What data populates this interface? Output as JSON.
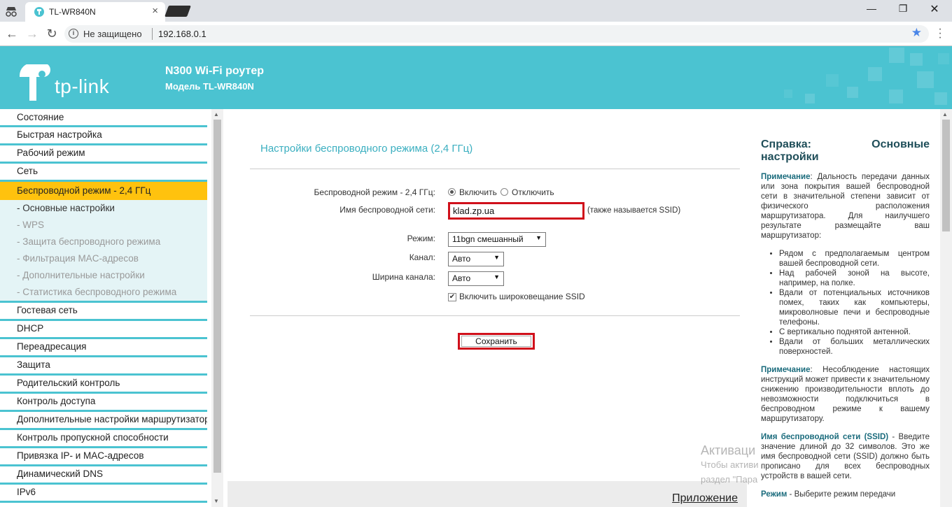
{
  "browser": {
    "tab_title": "TL-WR840N",
    "security_label": "Не защищено",
    "url": "192.168.0.1"
  },
  "header": {
    "logo_text": "tp-link",
    "product": "N300 Wi-Fi роутер",
    "model": "Модель TL-WR840N"
  },
  "sidebar": {
    "items_top": [
      "Состояние",
      "Быстрая настройка",
      "Рабочий режим",
      "Сеть"
    ],
    "active": "Беспроводной режим - 2,4 ГГц",
    "subitems": [
      "- Основные настройки",
      "- WPS",
      "- Защита беспроводного режима",
      "- Фильтрация MAC-адресов",
      "- Дополнительные настройки",
      "- Статистика беспроводного режима"
    ],
    "items_bottom": [
      "Гостевая сеть",
      "DHCP",
      "Переадресация",
      "Защита",
      "Родительский контроль",
      "Контроль доступа",
      "Дополнительные настройки маршрутизатора",
      "Контроль пропускной способности",
      "Привязка IP- и MAC-адресов",
      "Динамический DNS",
      "IPv6"
    ]
  },
  "form": {
    "title": "Настройки беспроводного режима (2,4 ГГц)",
    "wireless_label": "Беспроводной режим - 2,4 ГГц:",
    "enable": "Включить",
    "disable": "Отключить",
    "ssid_label": "Имя беспроводной сети:",
    "ssid_value": "klad.zp.ua",
    "ssid_note": "(также называется SSID)",
    "mode_label": "Режим:",
    "mode_value": "11bgn смешанный",
    "channel_label": "Канал:",
    "channel_value": "Авто",
    "width_label": "Ширина канала:",
    "width_value": "Авто",
    "broadcast_label": "Включить широковещание SSID",
    "save": "Сохранить",
    "appendix": "Приложение"
  },
  "help": {
    "title_left": "Справка:",
    "title_left2": "настройки",
    "title_right": "Основные",
    "note_label": "Примечание",
    "p1": ": Дальность передачи данных или зона покрытия вашей беспроводной сети в значительной степени зависит от физического расположения маршрутизатора. Для наилучшего результате размещайте ваш маршрутизатор:",
    "li1": "Рядом с предполагаемым центром вашей беспроводной сети.",
    "li2": "Над рабочей зоной на высоте, например, на полке.",
    "li3": "Вдали от потенциальных источников помех, таких как компьютеры, микроволновые печи и беспроводные телефоны.",
    "li4": "С вертикально поднятой антенной.",
    "li5": "Вдали от больших металлических поверхностей.",
    "p2": ": Несоблюдение настоящих инструкций может привести к значительному снижению производительности вплоть до невозможности подключиться в беспроводном режиме к вашему маршрутизатору.",
    "ssid_label": "Имя беспроводной сети (SSID)",
    "p3": " - Введите значение длиной до 32 символов. Это же имя беспроводной сети (SSID) должно быть прописано для всех беспроводных устройств в вашей сети.",
    "mode_label": "Режим",
    "p4": " - Выберите режим передачи"
  },
  "watermark": {
    "line1": "Активаци",
    "line2": "Чтобы активи",
    "line3": "раздел \"Пара"
  },
  "colors": {
    "brand": "#4bc3d1",
    "active_menu": "#ffc20e",
    "highlight_border": "#d0101b"
  }
}
